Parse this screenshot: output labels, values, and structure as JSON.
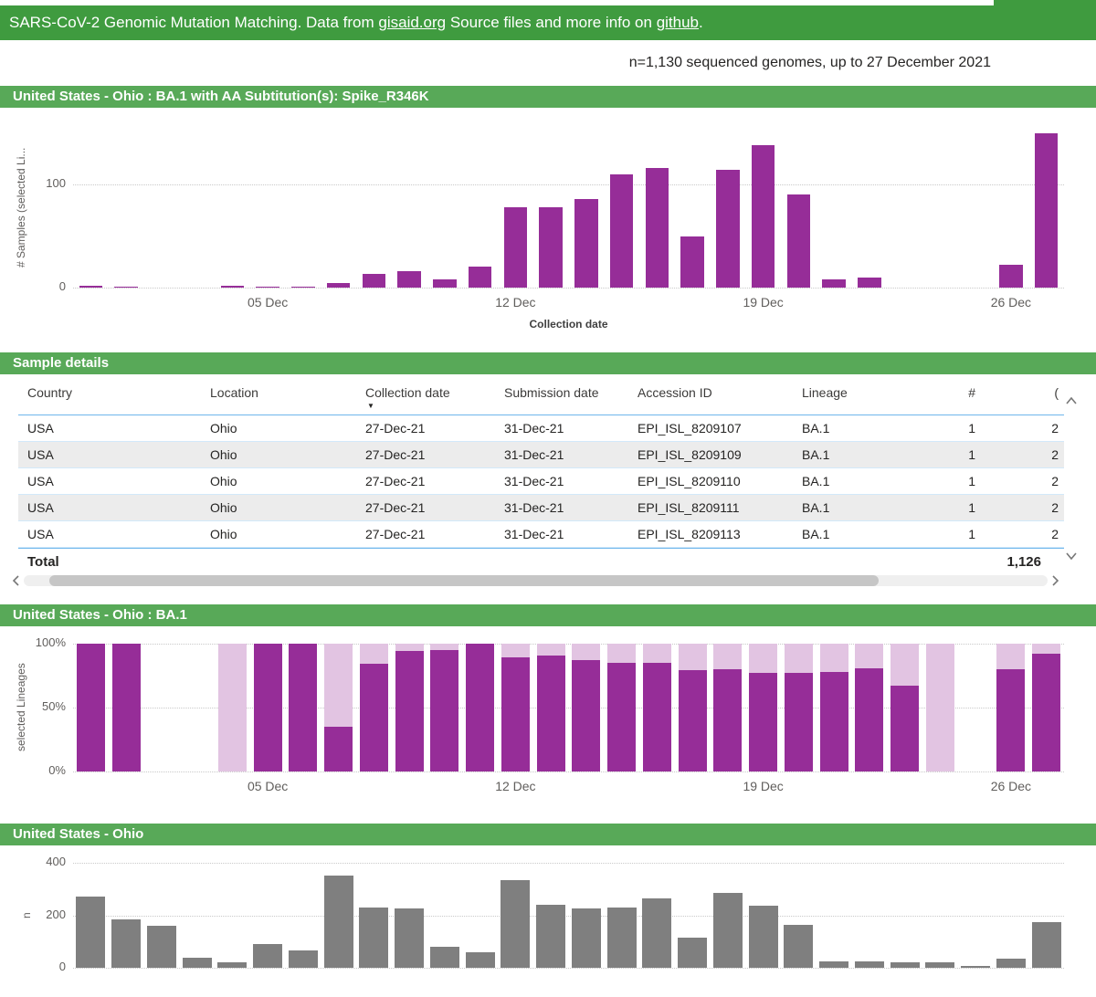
{
  "topbar": {
    "prefix": "SARS-CoV-2 Genomic Mutation Matching. Data from ",
    "gisaid_link": "gisaid.org",
    "middle": " Source files and more info on ",
    "github_link": "github",
    "suffix": "."
  },
  "summary_line": "n=1,130 sequenced genomes, up to 27 December 2021",
  "table": {
    "title": "Sample details",
    "columns": [
      "Country",
      "Location",
      "Collection date",
      "Submission date",
      "Accession ID",
      "Lineage",
      "#",
      "("
    ],
    "sort": {
      "column": "Collection date",
      "direction": "desc"
    },
    "rows": [
      [
        "USA",
        "Ohio",
        "27-Dec-21",
        "31-Dec-21",
        "EPI_ISL_8209107",
        "BA.1",
        "1",
        "2"
      ],
      [
        "USA",
        "Ohio",
        "27-Dec-21",
        "31-Dec-21",
        "EPI_ISL_8209109",
        "BA.1",
        "1",
        "2"
      ],
      [
        "USA",
        "Ohio",
        "27-Dec-21",
        "31-Dec-21",
        "EPI_ISL_8209110",
        "BA.1",
        "1",
        "2"
      ],
      [
        "USA",
        "Ohio",
        "27-Dec-21",
        "31-Dec-21",
        "EPI_ISL_8209111",
        "BA.1",
        "1",
        "2"
      ],
      [
        "USA",
        "Ohio",
        "27-Dec-21",
        "31-Dec-21",
        "EPI_ISL_8209113",
        "BA.1",
        "1",
        "2"
      ]
    ],
    "total_label": "Total",
    "total_value": "1,126"
  },
  "chart_data": [
    {
      "type": "bar",
      "title": "United States - Ohio : BA.1 with AA Subtitution(s): Spike_R346K",
      "ylabel": "# Samples (selected Li...",
      "xlabel": "Collection date",
      "ylim": [
        0,
        155
      ],
      "yticks": [
        {
          "v": 0,
          "label": "0"
        },
        {
          "v": 100,
          "label": "100"
        }
      ],
      "categories": [
        "30 Nov",
        "01 Dec",
        "02 Dec",
        "03 Dec",
        "04 Dec",
        "05 Dec",
        "06 Dec",
        "07 Dec",
        "08 Dec",
        "09 Dec",
        "10 Dec",
        "11 Dec",
        "12 Dec",
        "13 Dec",
        "14 Dec",
        "15 Dec",
        "16 Dec",
        "17 Dec",
        "18 Dec",
        "19 Dec",
        "20 Dec",
        "21 Dec",
        "22 Dec",
        "23 Dec",
        "24 Dec",
        "25 Dec",
        "26 Dec",
        "27 Dec"
      ],
      "values": [
        2,
        1,
        0,
        0,
        2,
        1,
        1,
        4,
        13,
        16,
        8,
        20,
        78,
        78,
        86,
        110,
        116,
        50,
        114,
        138,
        90,
        8,
        10,
        0,
        0,
        0,
        22,
        150
      ],
      "xticks": [
        {
          "i": 5,
          "label": "05 Dec"
        },
        {
          "i": 12,
          "label": "12 Dec"
        },
        {
          "i": 19,
          "label": "19 Dec"
        },
        {
          "i": 26,
          "label": "26 Dec"
        }
      ]
    },
    {
      "type": "stacked100",
      "title": "United States - Ohio : BA.1",
      "ylabel": "selected Lineages",
      "xlabel": "",
      "ylim": [
        0,
        100
      ],
      "yticks": [
        {
          "v": 0,
          "label": "0%"
        },
        {
          "v": 50,
          "label": "50%"
        },
        {
          "v": 100,
          "label": "100%"
        }
      ],
      "categories": [
        "30 Nov",
        "01 Dec",
        "02 Dec",
        "03 Dec",
        "04 Dec",
        "05 Dec",
        "06 Dec",
        "07 Dec",
        "08 Dec",
        "09 Dec",
        "10 Dec",
        "11 Dec",
        "12 Dec",
        "13 Dec",
        "14 Dec",
        "15 Dec",
        "16 Dec",
        "17 Dec",
        "18 Dec",
        "19 Dec",
        "20 Dec",
        "21 Dec",
        "22 Dec",
        "23 Dec",
        "24 Dec",
        "25 Dec",
        "26 Dec",
        "27 Dec"
      ],
      "series": [
        {
          "name": "selected",
          "values": [
            100,
            100,
            null,
            null,
            0,
            100,
            100,
            35,
            84,
            94,
            95,
            100,
            89,
            91,
            87,
            85,
            85,
            79,
            80,
            77,
            77,
            78,
            81,
            67,
            0,
            null,
            80,
            92
          ]
        },
        {
          "name": "other",
          "values": [
            0,
            0,
            null,
            null,
            100,
            0,
            0,
            65,
            16,
            6,
            5,
            0,
            11,
            9,
            13,
            15,
            15,
            21,
            20,
            23,
            23,
            22,
            19,
            33,
            100,
            null,
            20,
            8
          ]
        }
      ],
      "xticks": [
        {
          "i": 5,
          "label": "05 Dec"
        },
        {
          "i": 12,
          "label": "12 Dec"
        },
        {
          "i": 19,
          "label": "19 Dec"
        },
        {
          "i": 26,
          "label": "26 Dec"
        }
      ]
    },
    {
      "type": "bar",
      "title": "United States - Ohio",
      "ylabel": "n",
      "xlabel": "",
      "ylim": [
        0,
        400
      ],
      "yticks": [
        {
          "v": 0,
          "label": "0"
        },
        {
          "v": 200,
          "label": "200"
        },
        {
          "v": 400,
          "label": "400"
        }
      ],
      "categories": [
        "30 Nov",
        "01 Dec",
        "02 Dec",
        "03 Dec",
        "04 Dec",
        "05 Dec",
        "06 Dec",
        "07 Dec",
        "08 Dec",
        "09 Dec",
        "10 Dec",
        "11 Dec",
        "12 Dec",
        "13 Dec",
        "14 Dec",
        "15 Dec",
        "16 Dec",
        "17 Dec",
        "18 Dec",
        "19 Dec",
        "20 Dec",
        "21 Dec",
        "22 Dec",
        "23 Dec",
        "24 Dec",
        "25 Dec",
        "26 Dec",
        "27 Dec"
      ],
      "values": [
        270,
        185,
        160,
        40,
        20,
        90,
        65,
        350,
        230,
        225,
        80,
        60,
        335,
        240,
        225,
        230,
        265,
        115,
        285,
        235,
        165,
        25,
        25,
        20,
        20,
        8,
        35,
        175
      ],
      "xticks": []
    }
  ],
  "colors": {
    "green_dark": "#3f9b3f",
    "green_section": "#58a958",
    "purple": "#962d98",
    "purple_light": "#e2c4e2",
    "gray_bar": "#7f7f7f",
    "table_line_blue": "#6fb6ec"
  }
}
